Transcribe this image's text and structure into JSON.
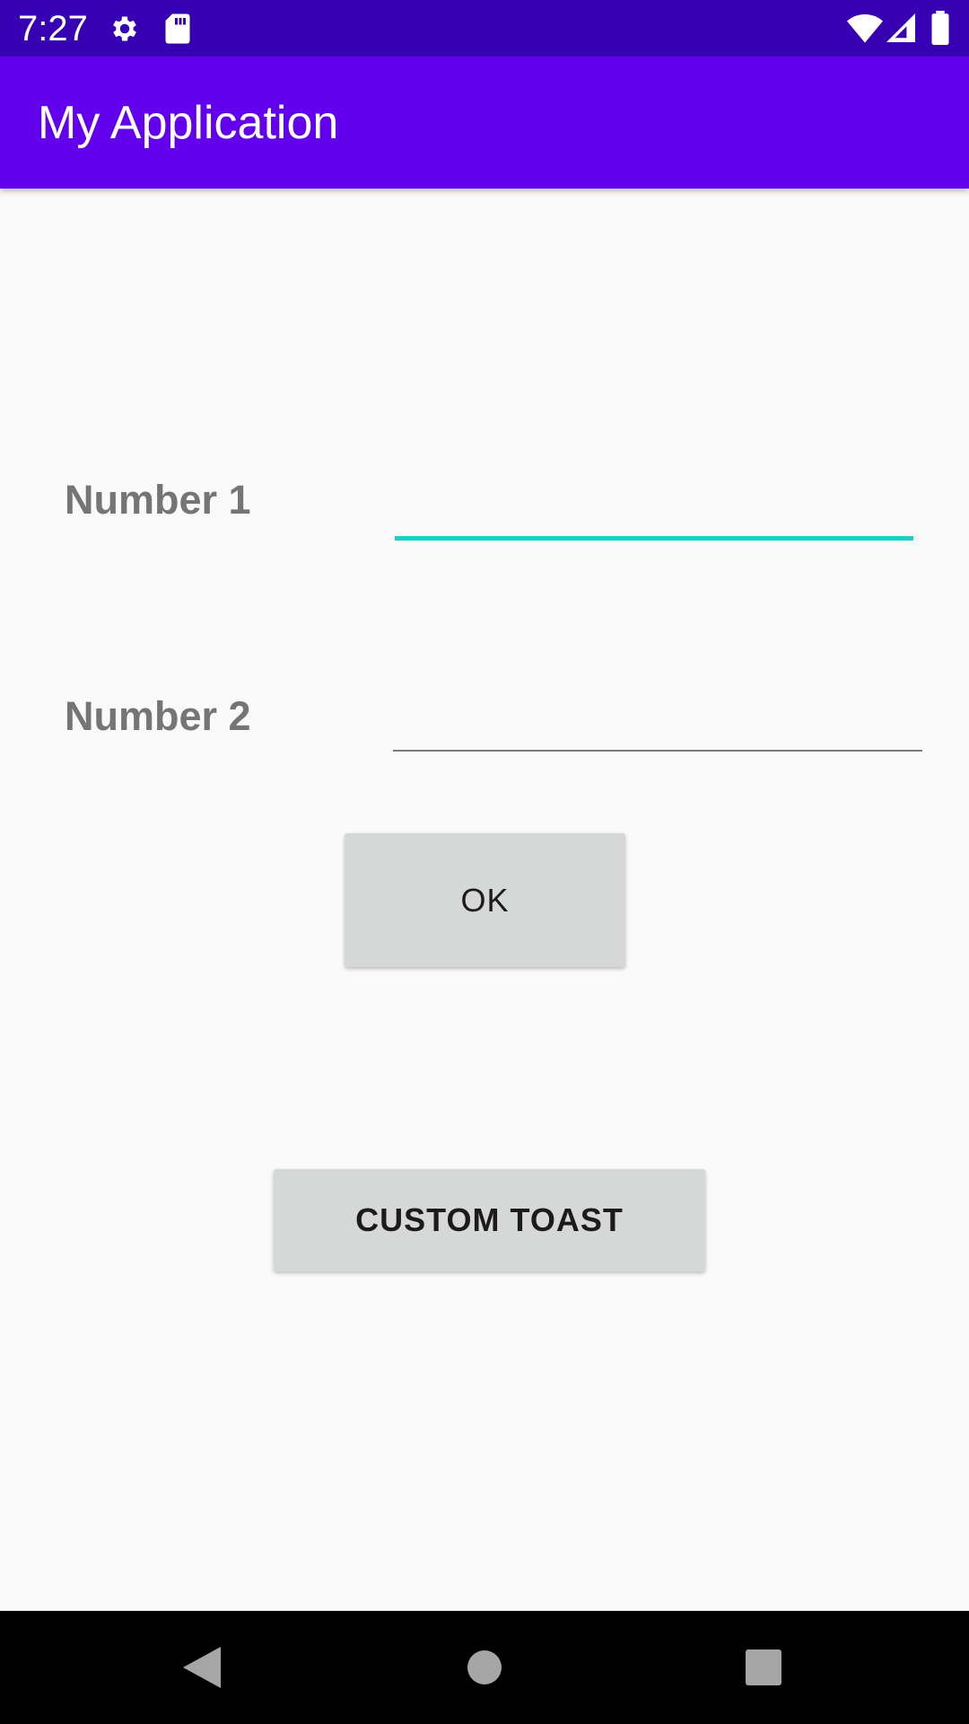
{
  "status_bar": {
    "time": "7:27",
    "icons": [
      "gear-icon",
      "sd-card-icon",
      "wifi-icon",
      "signal-icon",
      "battery-icon"
    ]
  },
  "app_bar": {
    "title": "My Application",
    "color": "#6200ee",
    "status_color": "#3700b3"
  },
  "form": {
    "number1_label": "Number 1",
    "number1_value": "",
    "number2_label": "Number 2",
    "number2_value": "",
    "focus_color": "#1ad1c4"
  },
  "buttons": {
    "ok_label": "OK",
    "custom_toast_label": "CUSTOM TOAST"
  },
  "nav_bar": {
    "icons": [
      "back-icon",
      "home-icon",
      "recents-icon"
    ]
  }
}
